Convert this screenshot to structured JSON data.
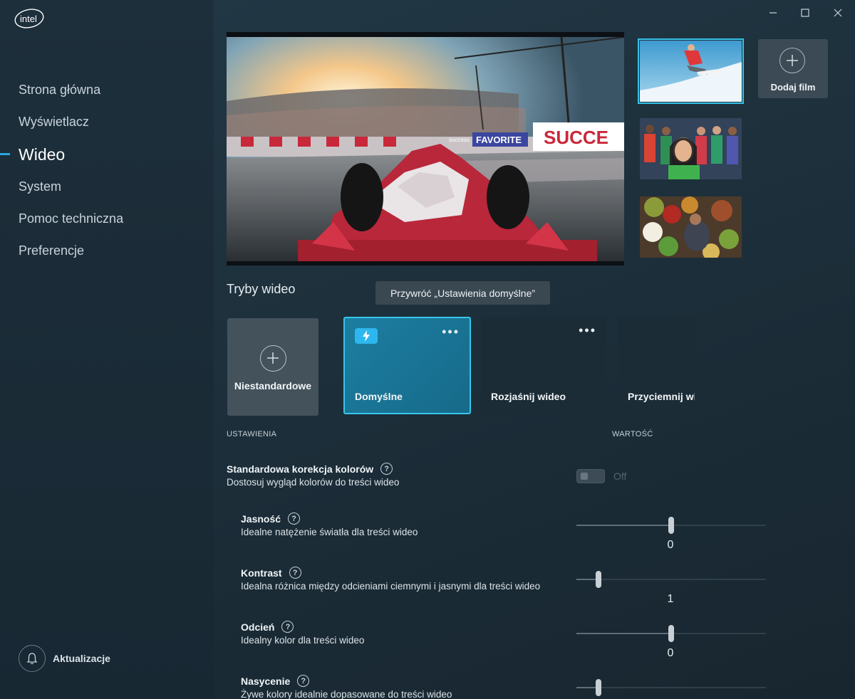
{
  "app": {
    "logo_text": "intel"
  },
  "window_controls": {
    "minimize": "minimize-icon",
    "maximize": "maximize-icon",
    "close": "close-icon"
  },
  "sidebar": {
    "items": [
      {
        "label": "Strona główna"
      },
      {
        "label": "Wyświetlacz"
      },
      {
        "label": "Wideo",
        "active": true
      },
      {
        "label": "System"
      },
      {
        "label": "Pomoc techniczna"
      },
      {
        "label": "Preferencje"
      }
    ],
    "updates_label": "Aktualizacje",
    "accent": "#29a8e0"
  },
  "media": {
    "add_film_label": "Dodaj film",
    "hero_banner_text": [
      "FAVORITE",
      "SUCCE",
      "success"
    ]
  },
  "modes": {
    "title": "Tryby wideo",
    "tooltip": "Przywróć „Ustawienia domyślne”",
    "items": [
      {
        "label": "Niestandardowe"
      },
      {
        "label": "Domyślne",
        "selected": true
      },
      {
        "label": "Rozjaśnij wideo"
      },
      {
        "label": "Przyciemnij wi"
      }
    ]
  },
  "settings": {
    "col_settings": "USTAWIENIA",
    "col_value": "WARTOŚĆ",
    "color_correction": {
      "title": "Standardowa korekcja kolorów",
      "desc": "Dostosuj wygląd kolorów do treści wideo",
      "toggle": "Off"
    },
    "sliders": [
      {
        "title": "Jasność",
        "desc": "Idealne natężenie światła dla treści wideo",
        "value": "0",
        "level": 0.5
      },
      {
        "title": "Kontrast",
        "desc": "Idealna różnica między odcieniami ciemnymi i jasnymi dla treści wideo",
        "value": "1",
        "level": 0.115
      },
      {
        "title": "Odcień",
        "desc": "Idealny kolor dla treści wideo",
        "value": "0",
        "level": 0.5
      },
      {
        "title": "Nasycenie",
        "desc": "Żywe kolory idealnie dopasowane do treści wideo",
        "value": "",
        "level": 0.115
      }
    ]
  }
}
